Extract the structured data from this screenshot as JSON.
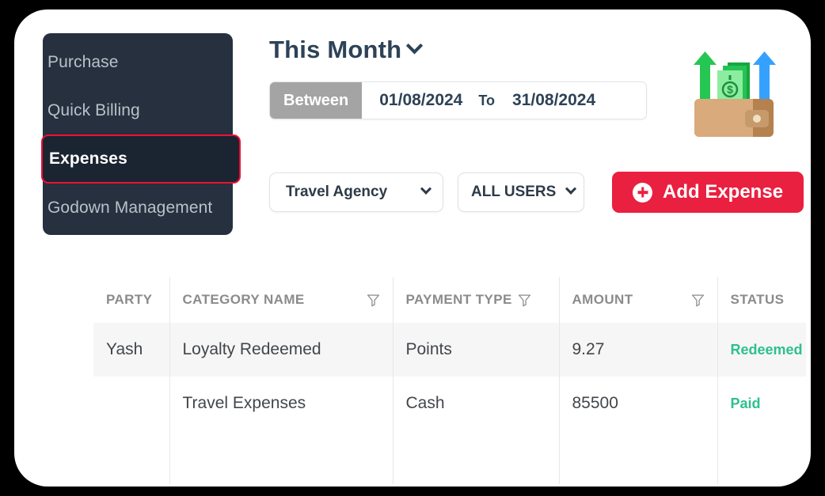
{
  "sidebar": {
    "items": [
      {
        "label": "Purchase",
        "active": false
      },
      {
        "label": "Quick Billing",
        "active": false
      },
      {
        "label": "Expenses",
        "active": true
      },
      {
        "label": "Godown Management",
        "active": false
      }
    ]
  },
  "header": {
    "period_label": "This Month",
    "period_chevron_icon": "chevron-down-icon",
    "date_range": {
      "mode_label": "Between",
      "from": "01/08/2024",
      "to_label": "To",
      "to": "31/08/2024"
    }
  },
  "filters": {
    "agency_select": {
      "value": "Travel Agency",
      "chevron_icon": "chevron-down-icon"
    },
    "users_select": {
      "value": "ALL USERS",
      "chevron_icon": "chevron-down-icon"
    },
    "add_expense_button": {
      "label": "Add Expense",
      "icon": "plus-circle-icon"
    }
  },
  "illustration": {
    "name": "wallet-with-money-icon"
  },
  "table": {
    "columns": [
      {
        "label": "PARTY",
        "filter": false
      },
      {
        "label": "CATEGORY NAME",
        "filter": true
      },
      {
        "label": "PAYMENT TYPE",
        "filter": true
      },
      {
        "label": "AMOUNT",
        "filter": true
      },
      {
        "label": "STATUS",
        "filter": false
      }
    ],
    "rows": [
      {
        "party": "Yash",
        "category": "Loyalty Redeemed",
        "payment_type": "Points",
        "amount": "9.27",
        "status": "Redeemed"
      },
      {
        "party": "",
        "category": "Travel Expenses",
        "payment_type": "Cash",
        "amount": "85500",
        "status": "Paid"
      }
    ]
  },
  "colors": {
    "accent_red": "#ea2040",
    "sidebar_bg": "#26303f",
    "highlight_border": "#ee1133",
    "status_green": "#2ec08e",
    "heading_navy": "#2d4257",
    "between_tag_gray": "#a4a4a4"
  }
}
